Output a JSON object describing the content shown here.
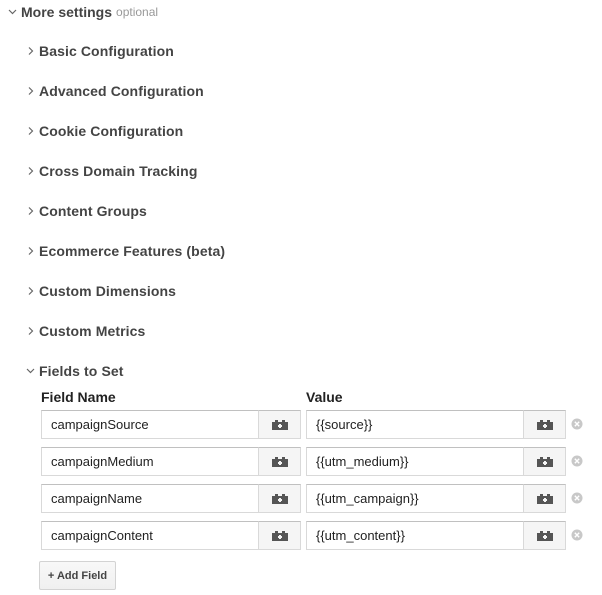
{
  "more_settings": {
    "title": "More settings",
    "optional_label": "optional"
  },
  "sections": [
    {
      "label": "Basic Configuration"
    },
    {
      "label": "Advanced Configuration"
    },
    {
      "label": "Cookie Configuration"
    },
    {
      "label": "Cross Domain Tracking"
    },
    {
      "label": "Content Groups"
    },
    {
      "label": "Ecommerce Features (beta)"
    },
    {
      "label": "Custom Dimensions"
    },
    {
      "label": "Custom Metrics"
    }
  ],
  "fields_to_set": {
    "title": "Fields to Set",
    "field_name_header": "Field Name",
    "value_header": "Value",
    "rows": [
      {
        "field": "campaignSource",
        "value": "{{source}}"
      },
      {
        "field": "campaignMedium",
        "value": "{{utm_medium}}"
      },
      {
        "field": "campaignName",
        "value": "{{utm_campaign}}"
      },
      {
        "field": "campaignContent",
        "value": "{{utm_content}}"
      }
    ],
    "add_field_label": "+ Add Field"
  },
  "icons": {
    "variable": "variable-picker-icon",
    "remove": "remove-circle-icon",
    "expand": "chevron-right-icon",
    "collapse": "chevron-down-icon"
  }
}
